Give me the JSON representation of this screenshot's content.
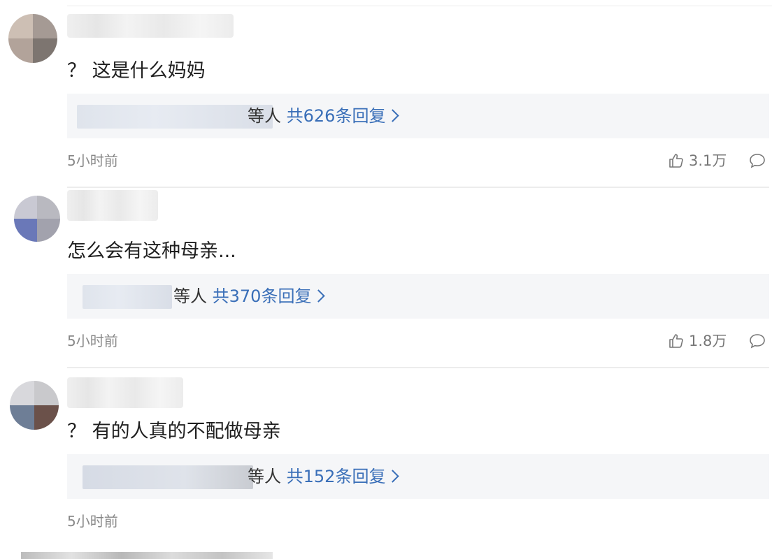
{
  "comments": [
    {
      "text": "？ 这是什么妈妈",
      "replies_prefix": "等人",
      "replies_count": "共626条回复",
      "time": "5小时前",
      "likes": "3.1万"
    },
    {
      "text": "怎么会有这种母亲...",
      "replies_prefix": "等人",
      "replies_count": "共370条回复",
      "time": "5小时前",
      "likes": "1.8万"
    },
    {
      "text": "？ 有的人真的不配做母亲",
      "replies_prefix": "等人",
      "replies_count": "共152条回复",
      "time": "5小时前"
    }
  ],
  "icons": {
    "like": "thumbs-up-icon",
    "reply": "comment-bubble-icon",
    "more": "chevron-right-icon"
  },
  "colors": {
    "link": "#3a6fb8",
    "time": "#888888",
    "reply_bg": "#f5f6f8"
  }
}
